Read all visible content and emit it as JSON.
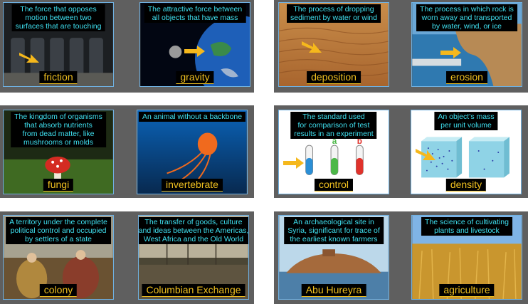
{
  "cards": [
    {
      "word": "friction",
      "definition": [
        "The force that opposes",
        "motion between two",
        "surfaces that are touching"
      ]
    },
    {
      "word": "gravity",
      "definition": [
        "The attractive force between",
        "all objects that have mass"
      ]
    },
    {
      "word": "deposition",
      "definition": [
        "The process of dropping",
        "sediment by water or wind"
      ]
    },
    {
      "word": "erosion",
      "definition": [
        "The process in which rock is",
        "worn away and transported",
        "by water, wind, or ice"
      ]
    },
    {
      "word": "fungi",
      "definition": [
        "The kingdom of organisms",
        "that absorb nutrients",
        "from dead matter, like",
        "mushrooms or molds"
      ]
    },
    {
      "word": "invertebrate",
      "definition": [
        "An animal without a backbone"
      ]
    },
    {
      "word": "control",
      "definition": [
        "The standard used",
        "for comparison of test",
        "results in an experiment"
      ],
      "tube_labels": [
        "a",
        "b"
      ]
    },
    {
      "word": "density",
      "definition": [
        "An object’s mass",
        "per unit volume"
      ]
    },
    {
      "word": "colony",
      "definition": [
        "A territory under the complete",
        "political control and occupied",
        "by settlers of a state"
      ]
    },
    {
      "word": "Columbian Exchange",
      "definition": [
        "The transfer of goods, culture",
        "and ideas between the Americas,",
        "West Africa and the Old World"
      ]
    },
    {
      "word": "Abu Hureyra",
      "definition": [
        "An archaeological site in",
        "Syria, significant for trace of",
        "the earliest known farmers"
      ]
    },
    {
      "word": "agriculture",
      "definition": [
        "The science of cultivating",
        "plants and livestock"
      ]
    }
  ]
}
